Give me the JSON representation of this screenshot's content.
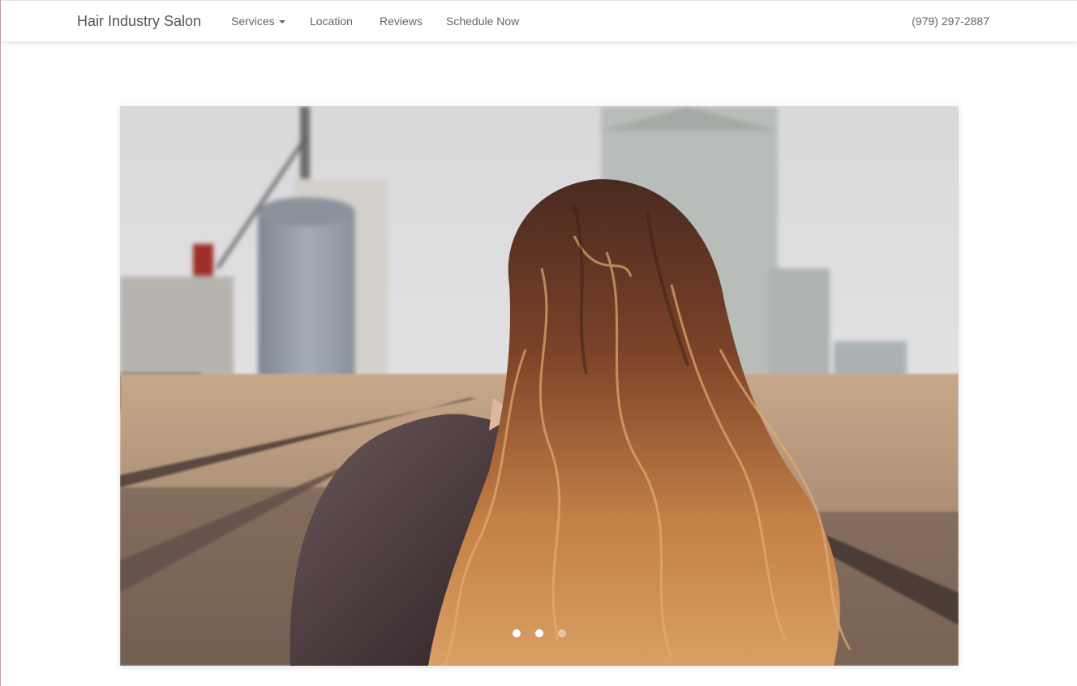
{
  "navbar": {
    "brand": "Hair Industry Salon",
    "items": [
      {
        "label": "Services",
        "has_dropdown": true
      },
      {
        "label": "Location"
      },
      {
        "label": "Reviews"
      },
      {
        "label": "Schedule Now"
      }
    ],
    "phone": "(979) 297-2887"
  },
  "carousel": {
    "slide_count": 3,
    "active_index": 0,
    "image_subject": "woman-with-long-wavy-hair-on-railroad-tracks"
  },
  "colors": {
    "nav_text": "#666666",
    "brand_text": "#555555",
    "background": "#ffffff"
  }
}
